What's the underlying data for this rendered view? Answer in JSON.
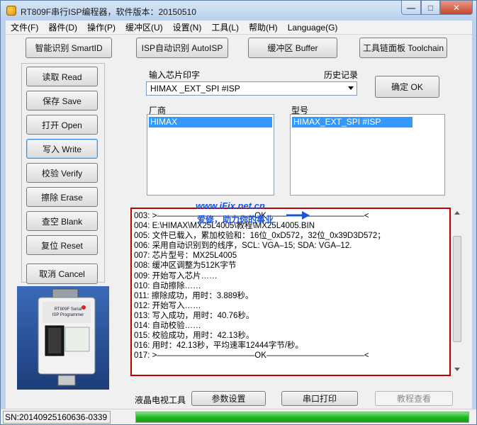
{
  "window": {
    "title": "RT809F串行ISP编程器，软件版本：20150510",
    "minimize": "—",
    "maximize": "□",
    "close": "✕"
  },
  "menu": [
    "文件(F)",
    "器件(D)",
    "操作(P)",
    "缓冲区(U)",
    "设置(N)",
    "工具(L)",
    "帮助(H)",
    "Language(G)"
  ],
  "toolbar": {
    "smart_id": "智能识别 SmartID",
    "isp_auto": "ISP自动识别 AutoISP",
    "buffer": "缓冲区 Buffer",
    "toolchain": "工具链面板 Toolchain"
  },
  "side": {
    "read": "读取 Read",
    "save": "保存 Save",
    "open": "打开 Open",
    "write": "写入 Write",
    "verify": "校验 Verify",
    "erase": "擦除 Erase",
    "blank": "查空 Blank",
    "reset": "复位 Reset",
    "cancel": "取消 Cancel"
  },
  "chip": {
    "input_label": "输入芯片印字",
    "history_label": "历史记录",
    "input_value": "HIMAX  _EXT_SPI #ISP",
    "ok_button": "确定 OK",
    "vendor_label": "厂商",
    "model_label": "型号",
    "vendor_selected": "HIMAX",
    "model_selected": "HIMAX_EXT_SPI #ISP"
  },
  "watermark": {
    "site": "www.iFix.net.cn",
    "slogan": "爱修，助力你的事业"
  },
  "log": [
    "003: >————————————OK————————————<",
    "004: E:\\HIMAX\\MX25L4005\\教程\\MX25L4005.BIN",
    "005: 文件已载入，累加校验和：16位_0xD572，32位_0x39D3D572；",
    "006: 采用自动识别到的线序，SCL: VGA–15; SDA: VGA–12.",
    "007: 芯片型号：MX25L4005",
    "008: 缓冲区调整为512K字节",
    "009: 开始写入芯片……",
    "010: 自动擦除……",
    "011: 擦除成功，用时：3.889秒。",
    "012: 开始写入……",
    "013: 写入成功，用时：40.76秒。",
    "014: 自动校验……",
    "015: 校验成功，用时：42.13秒。",
    "016: 用时：42.13秒，平均速率12444字节/秒。",
    "017: >————————————OK————————————<"
  ],
  "bottom": {
    "lcd_tool_label": "液晶电视工具",
    "params": "参数设置",
    "serial_print": "串口打印",
    "tutorial": "教程查看"
  },
  "status": {
    "sn": "SN:20140925160636-0339",
    "progress": 1.0
  },
  "device": {
    "label_line1": "RT809F Serial",
    "label_line2": "ISP Programmer"
  }
}
